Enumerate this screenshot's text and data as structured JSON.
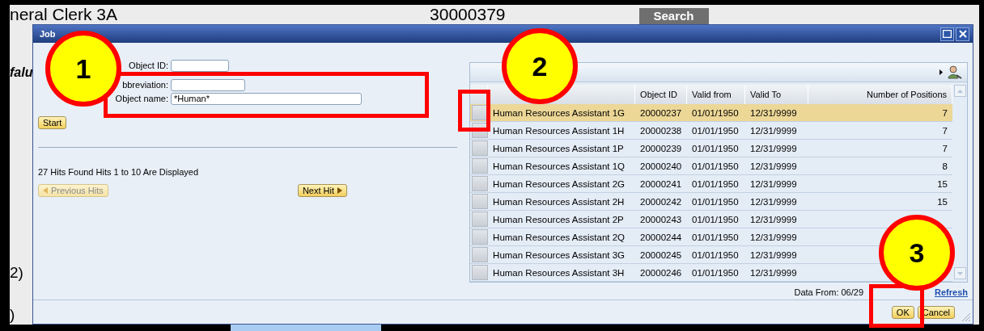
{
  "page": {
    "title": "neral Clerk 3A",
    "number": "30000379",
    "search_button": "Search",
    "label_1": "falu",
    "label_2": "2)",
    "label_3": ")"
  },
  "dialog": {
    "title": "Job",
    "fields": [
      {
        "label": "Object ID:"
      },
      {
        "label": "bbreviation:"
      },
      {
        "label": "Object name:",
        "value": "*Human*"
      }
    ],
    "start_button": "Start",
    "hits_text": "27 Hits Found Hits 1 to 10 Are Displayed",
    "previous_button": {
      "label": "Previous Hits",
      "disabled": true
    },
    "next_button": {
      "label": "Next Hit",
      "disabled": false
    },
    "table": {
      "columns": [
        "Object ID",
        "Valid from",
        "Valid To",
        "Number of Positions"
      ],
      "rows": [
        {
          "name": "Human Resources Assistant 1G",
          "object_id": "20000237",
          "valid_from": "01/01/1950",
          "valid_to": "12/31/9999",
          "positions": "7",
          "selected": true
        },
        {
          "name": "Human Resources Assistant 1H",
          "object_id": "20000238",
          "valid_from": "01/01/1950",
          "valid_to": "12/31/9999",
          "positions": "7",
          "selected": false
        },
        {
          "name": "Human Resources Assistant 1P",
          "object_id": "20000239",
          "valid_from": "01/01/1950",
          "valid_to": "12/31/9999",
          "positions": "7",
          "selected": false
        },
        {
          "name": "Human Resources Assistant 1Q",
          "object_id": "20000240",
          "valid_from": "01/01/1950",
          "valid_to": "12/31/9999",
          "positions": "8",
          "selected": false
        },
        {
          "name": "Human Resources Assistant 2G",
          "object_id": "20000241",
          "valid_from": "01/01/1950",
          "valid_to": "12/31/9999",
          "positions": "15",
          "selected": false
        },
        {
          "name": "Human Resources Assistant 2H",
          "object_id": "20000242",
          "valid_from": "01/01/1950",
          "valid_to": "12/31/9999",
          "positions": "15",
          "selected": false
        },
        {
          "name": "Human Resources Assistant 2P",
          "object_id": "20000243",
          "valid_from": "01/01/1950",
          "valid_to": "12/31/9999",
          "selected": false
        },
        {
          "name": "Human Resources Assistant 2Q",
          "object_id": "20000244",
          "valid_from": "01/01/1950",
          "valid_to": "12/31/9999",
          "selected": false
        },
        {
          "name": "Human Resources Assistant 3G",
          "object_id": "20000245",
          "valid_from": "01/01/1950",
          "valid_to": "12/31/9999",
          "selected": false
        },
        {
          "name": "Human Resources Assistant 3H",
          "object_id": "20000246",
          "valid_from": "01/01/1950",
          "valid_to": "12/31/9999",
          "selected": false
        }
      ]
    },
    "data_from": "Data From: 06/29",
    "refresh_link": "Refresh",
    "buttons": [
      {
        "label": "OK"
      },
      {
        "label": "Cancel"
      }
    ]
  },
  "annotations": [
    {
      "label": "1"
    },
    {
      "label": "2"
    },
    {
      "label": "3"
    }
  ]
}
